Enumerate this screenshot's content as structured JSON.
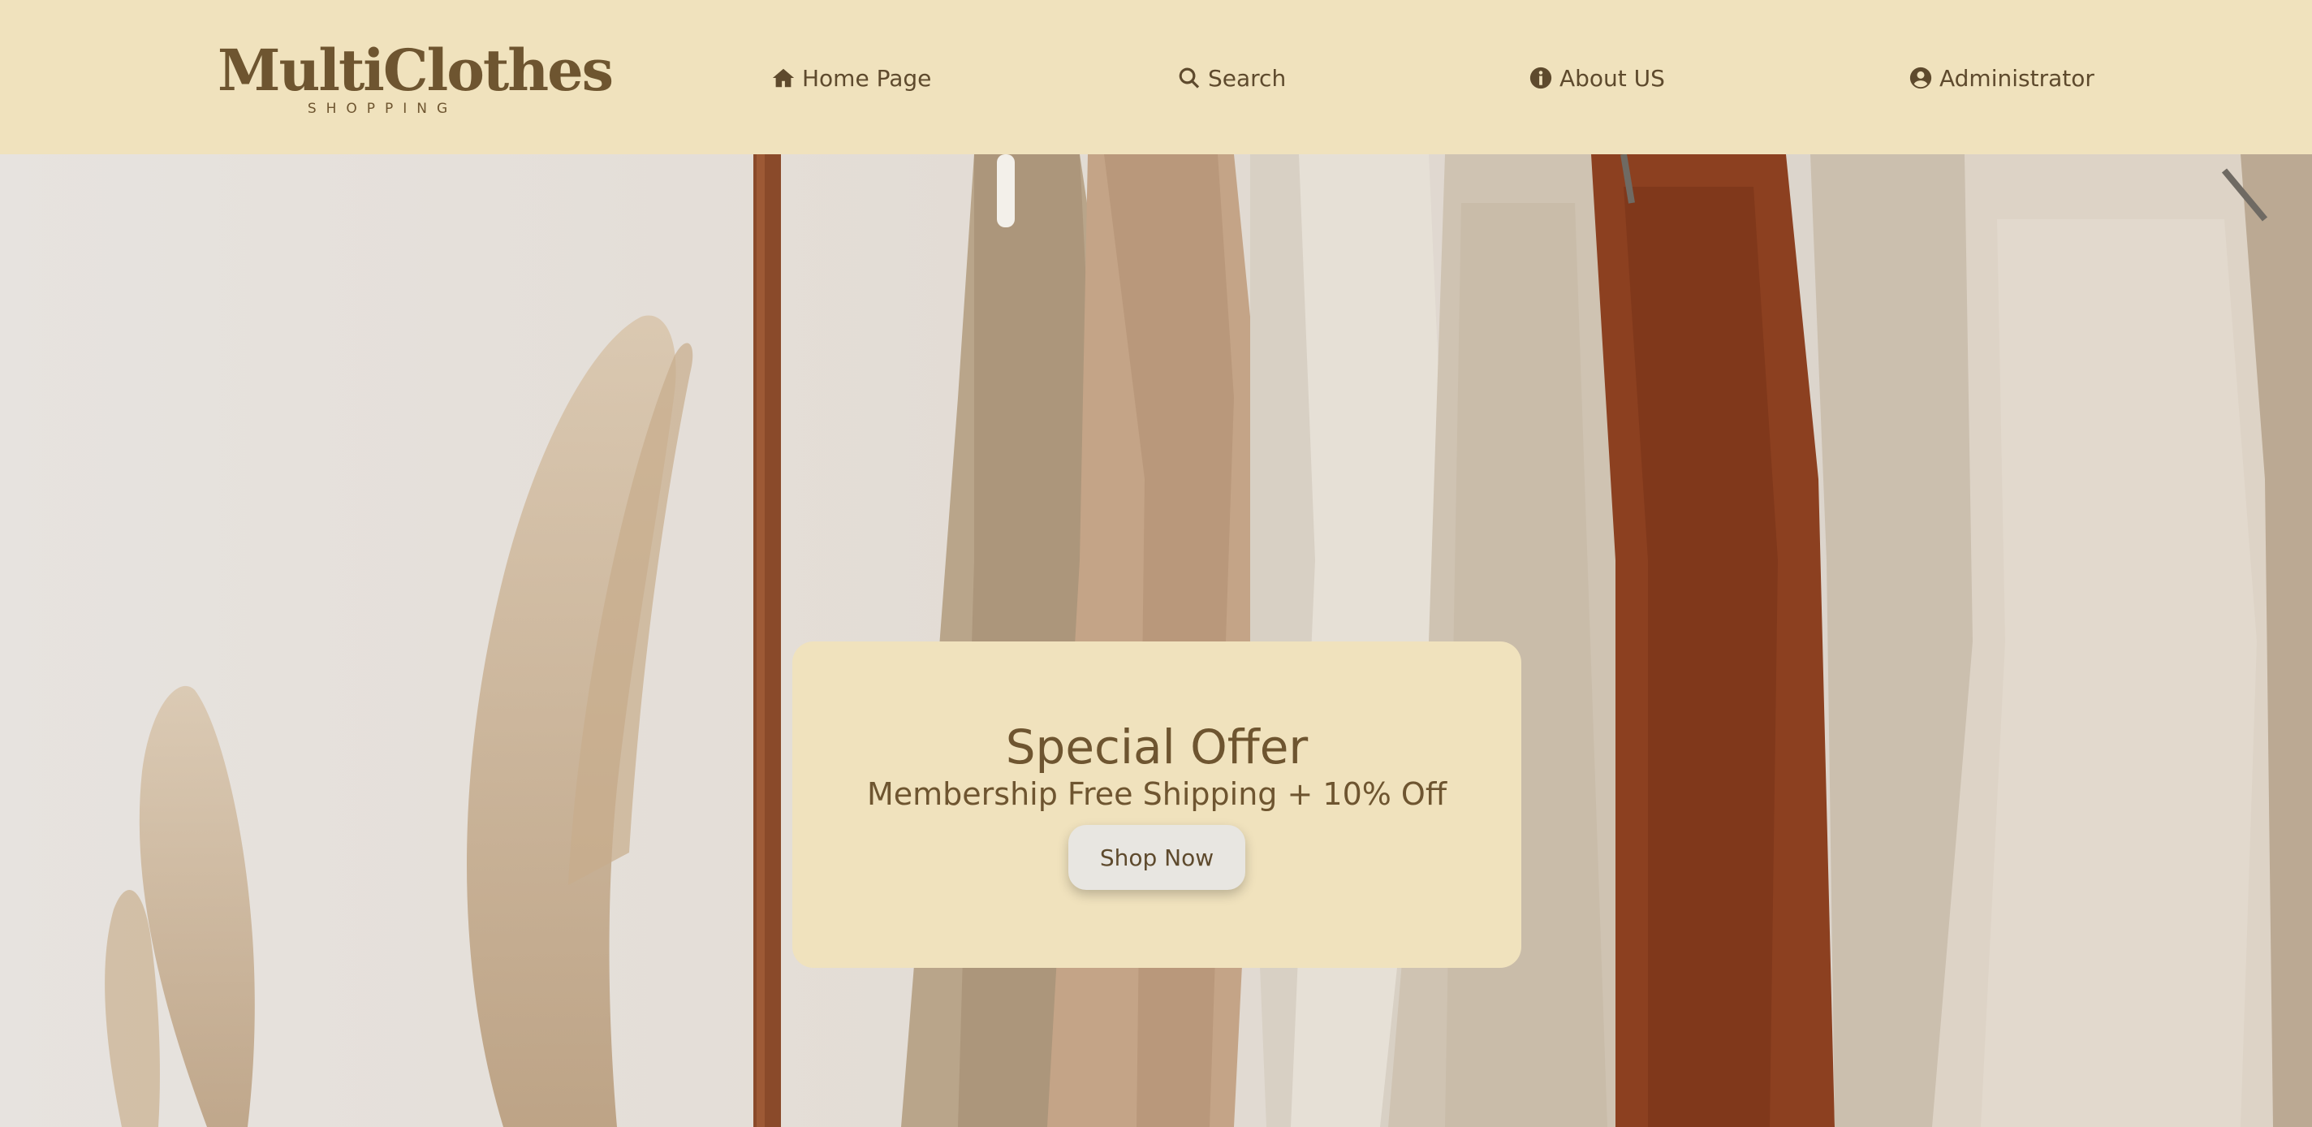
{
  "brand": {
    "title": "MultiClothes",
    "subtitle": "SHOPPING"
  },
  "nav": {
    "home": {
      "label": "Home Page",
      "icon": "home-icon"
    },
    "search": {
      "label": "Search",
      "icon": "search-icon"
    },
    "about": {
      "label": "About US",
      "icon": "info-circle-icon"
    },
    "admin": {
      "label": "Administrator",
      "icon": "user-circle-icon"
    }
  },
  "offer": {
    "title": "Special Offer",
    "subtitle": "Membership Free Shipping + 10% Off",
    "button_label": "Shop Now"
  },
  "colors": {
    "header_bg": "#f0e2bd",
    "brand_text": "#6e5530",
    "nav_text": "#5e4a2d",
    "button_bg": "#e8e6e1"
  }
}
